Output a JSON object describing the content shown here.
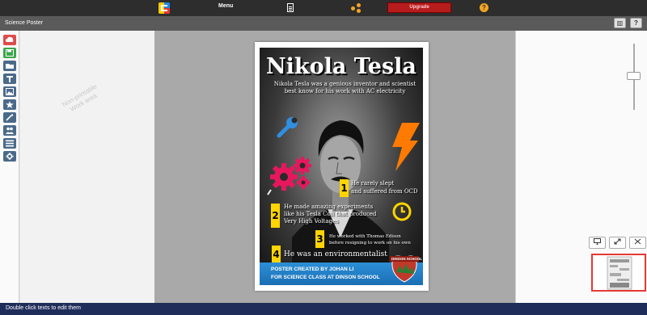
{
  "topbar": {
    "menu_label": "Menu",
    "upgrade_label": "Upgrade",
    "help_glyph": "?",
    "icons": [
      "app-logo",
      "document-icon",
      "share-icon",
      "help-icon"
    ],
    "upgrade_color": "#b71c1c"
  },
  "titlebar": {
    "doc_title": "Science Poster",
    "chart_glyph": "▥",
    "help_glyph": "?"
  },
  "left_toolbar": {
    "tools": [
      "upload-icon",
      "save-icon",
      "folder-icon",
      "text-icon",
      "image-icon",
      "star-icon",
      "magic-wand-icon",
      "people-icon",
      "list-icon",
      "settings-icon"
    ],
    "tool_colors": [
      "#e04b4b",
      "#3aa64a",
      "#4a6a8a",
      "#4a6a8a",
      "#4a6a8a",
      "#4a6a8a",
      "#4a6a8a",
      "#4a6a8a",
      "#4a6a8a",
      "#4a6a8a"
    ]
  },
  "workspace": {
    "watermark_line1": "Non-printable",
    "watermark_line2": "Work area"
  },
  "poster": {
    "title": "Nikola Tesla",
    "subtitle_line1": "Nikola Tesla was a genious  inventor and scientist",
    "subtitle_line2": "best know for his work with AC electricity",
    "facts": [
      {
        "number": "1",
        "line1": "He rarely slept",
        "line2": "and suffered from OCD"
      },
      {
        "number": "2",
        "line1": "He made amazing experiments",
        "line2": "like his Tesla Coil that produced",
        "line3": "Very High Voltages"
      },
      {
        "number": "3",
        "line1": "He worked with Thomas Edison",
        "line2": "before resigning to work on his own"
      },
      {
        "number": "4",
        "line1": "He was an environmentalist"
      }
    ],
    "footer_line1": "POSTER CREATED BY JOHAN LI",
    "footer_line2": "FOR SCIENCE CLASS AT DINSON SCHOOL",
    "badge_text": "DINSON SCHOOL",
    "accent_colors": {
      "number_box": "#ffd400",
      "wrench": "#2f8fe0",
      "bolt": "#ff7a00",
      "gears": "#e8175d",
      "footer": "#1f7cc4"
    }
  },
  "right_panel": {
    "view_buttons": [
      "monitor-icon",
      "expand-icon",
      "shrink-icon"
    ]
  },
  "statusbar": {
    "text": "Double click texts to edit them"
  }
}
